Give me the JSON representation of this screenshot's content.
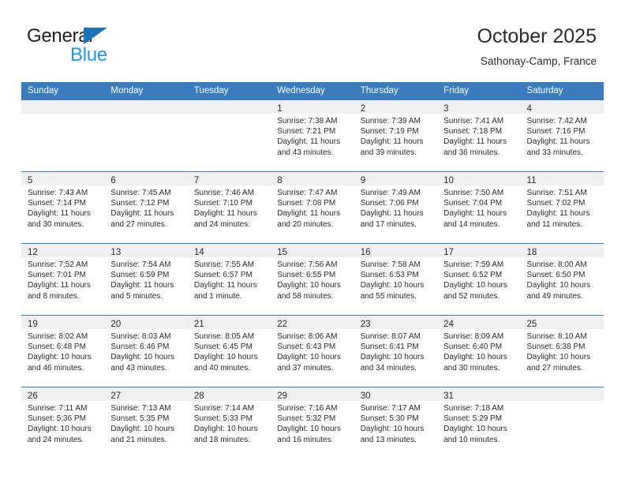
{
  "brand": {
    "name_part1": "General",
    "name_part2": "Blue",
    "logo_icon": "blue-triangle-logo"
  },
  "header": {
    "title": "October 2025",
    "location": "Sathonay-Camp, France"
  },
  "colors": {
    "header_blue": "#3a7cbe",
    "brand_blue": "#2196e3",
    "logo_blue": "#1b72b8",
    "daynum_strip": "#f0f0f0",
    "text": "#2b2b2b"
  },
  "weekday_headers": [
    "Sunday",
    "Monday",
    "Tuesday",
    "Wednesday",
    "Thursday",
    "Friday",
    "Saturday"
  ],
  "weeks": [
    [
      {
        "day": "",
        "sunrise": "",
        "sunset": "",
        "daylight1": "",
        "daylight2": "",
        "empty": true
      },
      {
        "day": "",
        "sunrise": "",
        "sunset": "",
        "daylight1": "",
        "daylight2": "",
        "empty": true
      },
      {
        "day": "",
        "sunrise": "",
        "sunset": "",
        "daylight1": "",
        "daylight2": "",
        "empty": true
      },
      {
        "day": "1",
        "sunrise": "Sunrise: 7:38 AM",
        "sunset": "Sunset: 7:21 PM",
        "daylight1": "Daylight: 11 hours",
        "daylight2": "and 43 minutes."
      },
      {
        "day": "2",
        "sunrise": "Sunrise: 7:39 AM",
        "sunset": "Sunset: 7:19 PM",
        "daylight1": "Daylight: 11 hours",
        "daylight2": "and 39 minutes."
      },
      {
        "day": "3",
        "sunrise": "Sunrise: 7:41 AM",
        "sunset": "Sunset: 7:18 PM",
        "daylight1": "Daylight: 11 hours",
        "daylight2": "and 36 minutes."
      },
      {
        "day": "4",
        "sunrise": "Sunrise: 7:42 AM",
        "sunset": "Sunset: 7:16 PM",
        "daylight1": "Daylight: 11 hours",
        "daylight2": "and 33 minutes."
      }
    ],
    [
      {
        "day": "5",
        "sunrise": "Sunrise: 7:43 AM",
        "sunset": "Sunset: 7:14 PM",
        "daylight1": "Daylight: 11 hours",
        "daylight2": "and 30 minutes."
      },
      {
        "day": "6",
        "sunrise": "Sunrise: 7:45 AM",
        "sunset": "Sunset: 7:12 PM",
        "daylight1": "Daylight: 11 hours",
        "daylight2": "and 27 minutes."
      },
      {
        "day": "7",
        "sunrise": "Sunrise: 7:46 AM",
        "sunset": "Sunset: 7:10 PM",
        "daylight1": "Daylight: 11 hours",
        "daylight2": "and 24 minutes."
      },
      {
        "day": "8",
        "sunrise": "Sunrise: 7:47 AM",
        "sunset": "Sunset: 7:08 PM",
        "daylight1": "Daylight: 11 hours",
        "daylight2": "and 20 minutes."
      },
      {
        "day": "9",
        "sunrise": "Sunrise: 7:49 AM",
        "sunset": "Sunset: 7:06 PM",
        "daylight1": "Daylight: 11 hours",
        "daylight2": "and 17 minutes."
      },
      {
        "day": "10",
        "sunrise": "Sunrise: 7:50 AM",
        "sunset": "Sunset: 7:04 PM",
        "daylight1": "Daylight: 11 hours",
        "daylight2": "and 14 minutes."
      },
      {
        "day": "11",
        "sunrise": "Sunrise: 7:51 AM",
        "sunset": "Sunset: 7:02 PM",
        "daylight1": "Daylight: 11 hours",
        "daylight2": "and 11 minutes."
      }
    ],
    [
      {
        "day": "12",
        "sunrise": "Sunrise: 7:52 AM",
        "sunset": "Sunset: 7:01 PM",
        "daylight1": "Daylight: 11 hours",
        "daylight2": "and 8 minutes."
      },
      {
        "day": "13",
        "sunrise": "Sunrise: 7:54 AM",
        "sunset": "Sunset: 6:59 PM",
        "daylight1": "Daylight: 11 hours",
        "daylight2": "and 5 minutes."
      },
      {
        "day": "14",
        "sunrise": "Sunrise: 7:55 AM",
        "sunset": "Sunset: 6:57 PM",
        "daylight1": "Daylight: 11 hours",
        "daylight2": "and 1 minute."
      },
      {
        "day": "15",
        "sunrise": "Sunrise: 7:56 AM",
        "sunset": "Sunset: 6:55 PM",
        "daylight1": "Daylight: 10 hours",
        "daylight2": "and 58 minutes."
      },
      {
        "day": "16",
        "sunrise": "Sunrise: 7:58 AM",
        "sunset": "Sunset: 6:53 PM",
        "daylight1": "Daylight: 10 hours",
        "daylight2": "and 55 minutes."
      },
      {
        "day": "17",
        "sunrise": "Sunrise: 7:59 AM",
        "sunset": "Sunset: 6:52 PM",
        "daylight1": "Daylight: 10 hours",
        "daylight2": "and 52 minutes."
      },
      {
        "day": "18",
        "sunrise": "Sunrise: 8:00 AM",
        "sunset": "Sunset: 6:50 PM",
        "daylight1": "Daylight: 10 hours",
        "daylight2": "and 49 minutes."
      }
    ],
    [
      {
        "day": "19",
        "sunrise": "Sunrise: 8:02 AM",
        "sunset": "Sunset: 6:48 PM",
        "daylight1": "Daylight: 10 hours",
        "daylight2": "and 46 minutes."
      },
      {
        "day": "20",
        "sunrise": "Sunrise: 8:03 AM",
        "sunset": "Sunset: 6:46 PM",
        "daylight1": "Daylight: 10 hours",
        "daylight2": "and 43 minutes."
      },
      {
        "day": "21",
        "sunrise": "Sunrise: 8:05 AM",
        "sunset": "Sunset: 6:45 PM",
        "daylight1": "Daylight: 10 hours",
        "daylight2": "and 40 minutes."
      },
      {
        "day": "22",
        "sunrise": "Sunrise: 8:06 AM",
        "sunset": "Sunset: 6:43 PM",
        "daylight1": "Daylight: 10 hours",
        "daylight2": "and 37 minutes."
      },
      {
        "day": "23",
        "sunrise": "Sunrise: 8:07 AM",
        "sunset": "Sunset: 6:41 PM",
        "daylight1": "Daylight: 10 hours",
        "daylight2": "and 34 minutes."
      },
      {
        "day": "24",
        "sunrise": "Sunrise: 8:09 AM",
        "sunset": "Sunset: 6:40 PM",
        "daylight1": "Daylight: 10 hours",
        "daylight2": "and 30 minutes."
      },
      {
        "day": "25",
        "sunrise": "Sunrise: 8:10 AM",
        "sunset": "Sunset: 6:38 PM",
        "daylight1": "Daylight: 10 hours",
        "daylight2": "and 27 minutes."
      }
    ],
    [
      {
        "day": "26",
        "sunrise": "Sunrise: 7:11 AM",
        "sunset": "Sunset: 5:36 PM",
        "daylight1": "Daylight: 10 hours",
        "daylight2": "and 24 minutes."
      },
      {
        "day": "27",
        "sunrise": "Sunrise: 7:13 AM",
        "sunset": "Sunset: 5:35 PM",
        "daylight1": "Daylight: 10 hours",
        "daylight2": "and 21 minutes."
      },
      {
        "day": "28",
        "sunrise": "Sunrise: 7:14 AM",
        "sunset": "Sunset: 5:33 PM",
        "daylight1": "Daylight: 10 hours",
        "daylight2": "and 18 minutes."
      },
      {
        "day": "29",
        "sunrise": "Sunrise: 7:16 AM",
        "sunset": "Sunset: 5:32 PM",
        "daylight1": "Daylight: 10 hours",
        "daylight2": "and 16 minutes."
      },
      {
        "day": "30",
        "sunrise": "Sunrise: 7:17 AM",
        "sunset": "Sunset: 5:30 PM",
        "daylight1": "Daylight: 10 hours",
        "daylight2": "and 13 minutes."
      },
      {
        "day": "31",
        "sunrise": "Sunrise: 7:18 AM",
        "sunset": "Sunset: 5:29 PM",
        "daylight1": "Daylight: 10 hours",
        "daylight2": "and 10 minutes."
      },
      {
        "day": "",
        "sunrise": "",
        "sunset": "",
        "daylight1": "",
        "daylight2": "",
        "empty": true
      }
    ]
  ]
}
